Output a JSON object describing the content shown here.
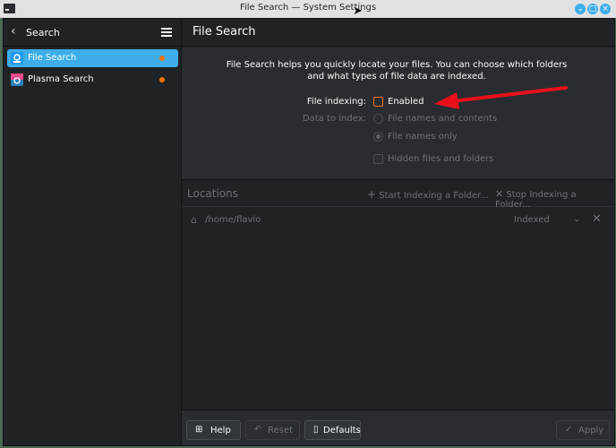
{
  "window": {
    "title": "File Search — System Settings"
  },
  "colors": {
    "accent": "#3daee9",
    "warning": "#f67400",
    "annotation": "#e8111b"
  },
  "sidebar": {
    "back_label": "Search",
    "items": [
      {
        "label": "File Search",
        "icon": "file-search-icon",
        "active": true
      },
      {
        "label": "Plasma Search",
        "icon": "plasma-search-icon",
        "active": false
      }
    ]
  },
  "main": {
    "title": "File Search",
    "intro": "File Search helps you quickly locate your files. You can choose which folders and what types of file data are indexed.",
    "file_indexing_label": "File indexing:",
    "enabled_label": "Enabled",
    "data_to_index_label": "Data to index:",
    "option_contents": "File names and contents",
    "option_names_only": "File names only",
    "hidden_files_label": "Hidden files and folders"
  },
  "locations": {
    "title": "Locations",
    "start_label": "Start Indexing a Folder...",
    "stop_label": "Stop Indexing a Folder...",
    "rows": [
      {
        "path": "/home/flavio",
        "status": "Indexed"
      }
    ]
  },
  "footer": {
    "help": "Help",
    "reset": "Reset",
    "defaults": "Defaults",
    "apply": "Apply"
  }
}
